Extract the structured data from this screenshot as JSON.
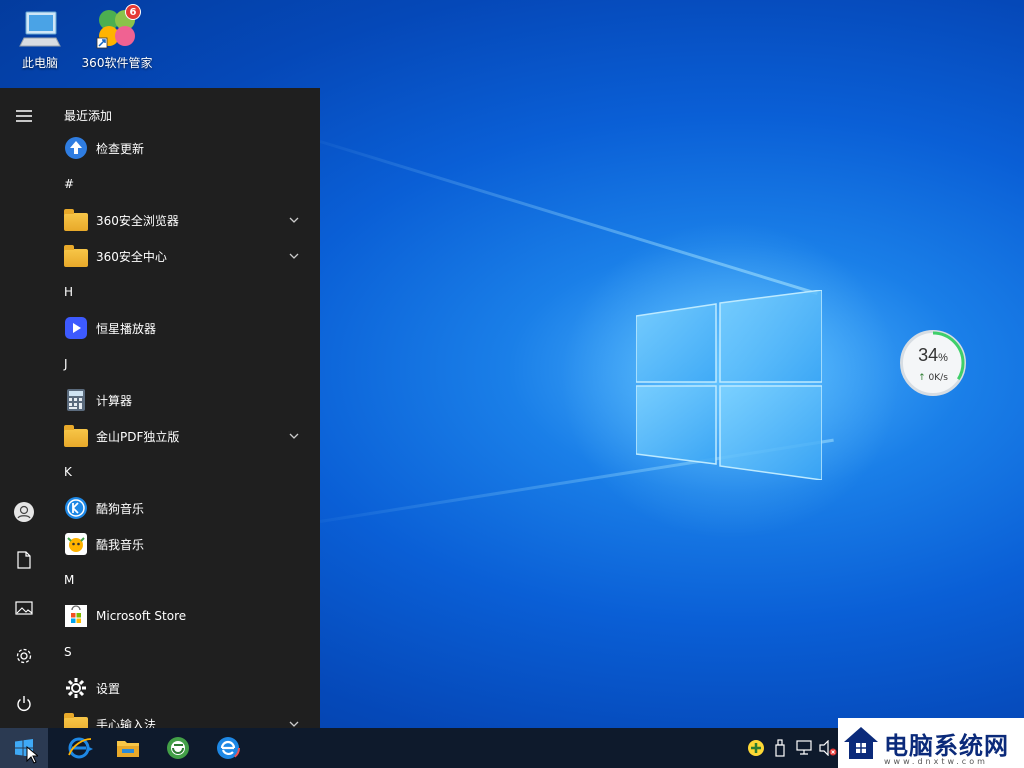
{
  "desktop": {
    "icons": [
      {
        "label": "此电脑"
      },
      {
        "label": "360软件管家",
        "badge": "6"
      }
    ]
  },
  "start_menu": {
    "recently_added_header": "最近添加",
    "items": [
      {
        "type": "app",
        "label": "检查更新"
      },
      {
        "type": "group",
        "label": "#"
      },
      {
        "type": "folder",
        "label": "360安全浏览器"
      },
      {
        "type": "folder",
        "label": "360安全中心"
      },
      {
        "type": "group",
        "label": "H"
      },
      {
        "type": "app",
        "label": "恒星播放器"
      },
      {
        "type": "group",
        "label": "J"
      },
      {
        "type": "app",
        "label": "计算器"
      },
      {
        "type": "folder",
        "label": "金山PDF独立版"
      },
      {
        "type": "group",
        "label": "K"
      },
      {
        "type": "app",
        "label": "酷狗音乐"
      },
      {
        "type": "app",
        "label": "酷我音乐"
      },
      {
        "type": "group",
        "label": "M"
      },
      {
        "type": "app",
        "label": "Microsoft Store"
      },
      {
        "type": "group",
        "label": "S"
      },
      {
        "type": "app",
        "label": "设置"
      },
      {
        "type": "folder",
        "label": "手心输入法"
      }
    ]
  },
  "speed_widget": {
    "percent": "34",
    "percent_unit": "%",
    "rate": "0K/s"
  },
  "watermark": {
    "text": "电脑系统网",
    "sub": "www.dnxtw.com"
  },
  "colors": {
    "accent": "#0a5fd6",
    "start_bg": "#1f1f1f",
    "taskbar_bg": "#0e1a2c"
  }
}
